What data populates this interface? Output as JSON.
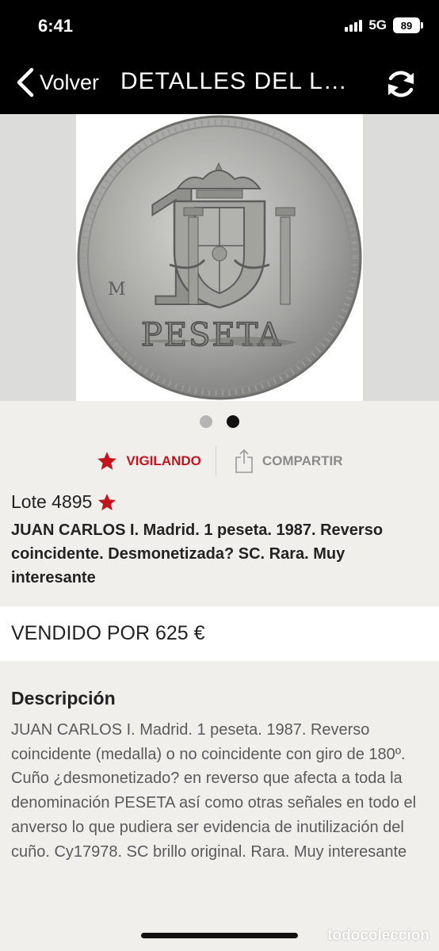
{
  "status_bar": {
    "time": "6:41",
    "network": "5G",
    "battery": "89"
  },
  "header": {
    "back_label": "Volver",
    "title": "DETALLES DEL LOTE",
    "refresh_icon": "refresh-icon"
  },
  "gallery": {
    "image_subject": "coin",
    "coin_texts": {
      "denomination": "1",
      "word": "PESETA",
      "mint_mark": "M"
    },
    "page_count": 2,
    "active_index": 1
  },
  "actions": {
    "watch_label": "VIGILANDO",
    "share_label": "COMPARTIR"
  },
  "lot": {
    "label": "Lote 4895",
    "title": "JUAN CARLOS I. Madrid. 1 peseta. 1987. Reverso coincidente. Desmonetizada? SC. Rara. Muy interesante"
  },
  "sold": {
    "text": "VENDIDO POR 625 €"
  },
  "description": {
    "heading": "Descripción",
    "body": "JUAN CARLOS I. Madrid. 1 peseta. 1987. Reverso coincidente (medalla) o no coincidente con giro de 180º. Cuño ¿desmonetizado? en reverso que afecta a toda la denominación PESETA así como otras señales en todo el anverso lo que pudiera ser evidencia de inutilización del cuño. Cy17978. SC brillo original. Rara. Muy interesante"
  },
  "watermark": "todocoleccion",
  "colors": {
    "accent": "#c4141b",
    "header_bg": "#000000",
    "page_bg": "#f0efeb",
    "muted": "#8a8a8a"
  }
}
